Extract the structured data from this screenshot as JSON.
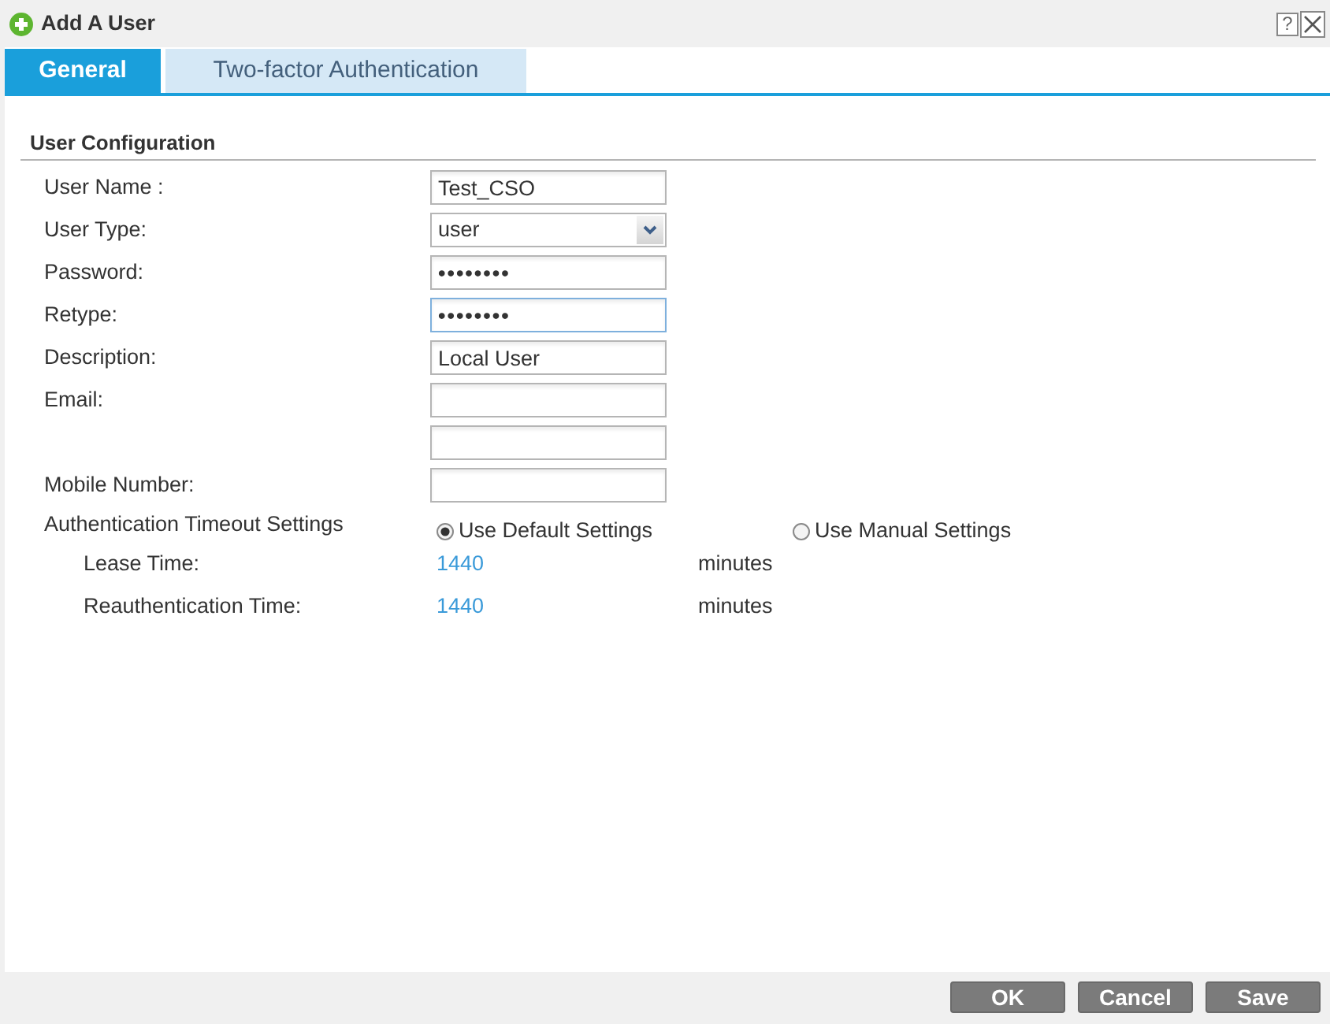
{
  "window": {
    "title": "Add A User",
    "help_label": "?"
  },
  "tabs": [
    {
      "label": "General",
      "selected": true
    },
    {
      "label": "Two-factor Authentication",
      "selected": false
    }
  ],
  "user_configuration": {
    "title": "User Configuration",
    "fields": [
      {
        "label": "User Name :",
        "kind": "text",
        "value": "Test_CSO",
        "focused": false
      },
      {
        "label": "User Type:",
        "kind": "select",
        "value": "user",
        "focused": false
      },
      {
        "label": "Password:",
        "kind": "password",
        "value": "••••••••",
        "focused": false
      },
      {
        "label": "Retype:",
        "kind": "password",
        "value": "••••••••",
        "focused": true
      },
      {
        "label": "Description:",
        "kind": "text",
        "value": "Local User",
        "focused": false
      },
      {
        "label": "Email:",
        "kind": "text",
        "focused": false
      },
      {
        "kind": "text",
        "focused": false
      },
      {
        "label": "Mobile Number:",
        "kind": "text",
        "focused": false
      }
    ],
    "authentication_timeout": {
      "label": "Authentication Timeout Settings",
      "options": [
        {
          "label": "Use Default Settings",
          "selected": true
        },
        {
          "label": "Use Manual Settings",
          "selected": false
        }
      ],
      "times": [
        {
          "label": "Lease Time:",
          "value": "1440",
          "unit": "minutes"
        },
        {
          "label": "Reauthentication Time:",
          "value": "1440",
          "unit": "minutes"
        }
      ]
    }
  },
  "buttons": [
    {
      "label": "OK"
    },
    {
      "label": "Cancel"
    },
    {
      "label": "Save"
    }
  ]
}
